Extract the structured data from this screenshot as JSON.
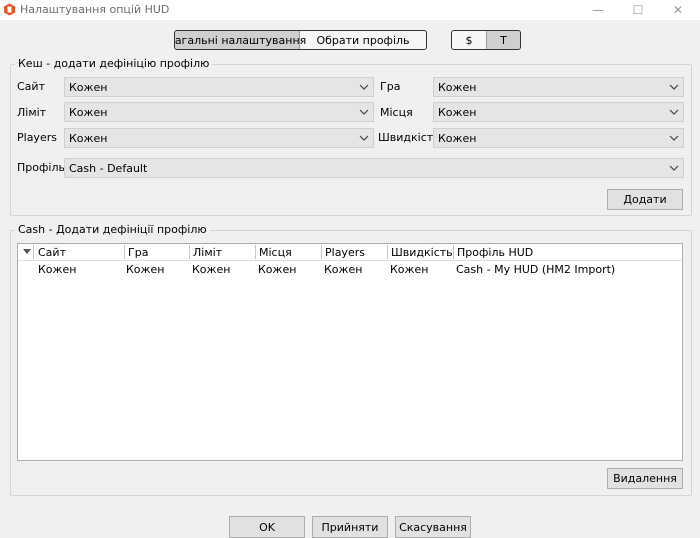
{
  "window": {
    "title": "Налаштування опцій HUD",
    "icon": "hm-logo-icon",
    "controls": {
      "minimize": "—",
      "maximize": "☐",
      "close": "✕"
    }
  },
  "top_tabs": {
    "general": "Загальні налаштування",
    "choose_profile": "Обрати профіль",
    "currency": "$",
    "tournament": "T",
    "active": "general"
  },
  "cache_group": {
    "title": "Кеш - додати дефініцію профілю",
    "site_label": "Сайт",
    "site_value": "Кожен",
    "game_label": "Гра",
    "game_value": "Кожен",
    "limit_label": "Ліміт",
    "limit_value": "Кожен",
    "seats_label": "Місця",
    "seats_value": "Кожен",
    "players_label": "Players",
    "players_value": "Кожен",
    "speed_label": "Швидкість",
    "speed_value": "Кожен",
    "profile_label": "Профіль",
    "profile_value": "Cash - Default",
    "add_button": "Додати"
  },
  "cash_group": {
    "title": "Cash - Додати дефініції профілю",
    "columns": [
      "Сайт",
      "Гра",
      "Ліміт",
      "Місця",
      "Players",
      "Швидкість",
      "Профіль HUD"
    ],
    "rows": [
      [
        "Кожен",
        "Кожен",
        "Кожен",
        "Кожен",
        "Кожен",
        "Кожен",
        "Cash - My HUD (HM2 Import)"
      ]
    ],
    "delete_button": "Видалення"
  },
  "footer": {
    "ok": "OK",
    "apply": "Прийняти",
    "cancel": "Скасування"
  },
  "colors": {
    "window_bg": "#f0f0f0",
    "combo_bg": "#e5e5e5",
    "active_tab_bg": "#cfcfcf",
    "icon_orange": "#e8541e"
  }
}
